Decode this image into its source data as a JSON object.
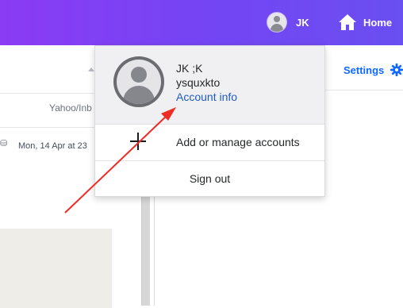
{
  "topbar": {
    "user_initials": "JK",
    "home_label": "Home"
  },
  "left_panel": {
    "folder_path": "Yahoo/Inb",
    "message_date": "Mon, 14 Apr at 23"
  },
  "right_panel": {
    "settings_label": "Settings"
  },
  "account_menu": {
    "display_name": "JK ;K",
    "username": "ysquxkto",
    "account_info_label": "Account info",
    "add_accounts_label": "Add or manage accounts",
    "sign_out_label": "Sign out"
  },
  "colors": {
    "topbar_gradient_start": "#8a3bf4",
    "topbar_gradient_end": "#6a4ff2",
    "link_blue": "#1d5dbf",
    "settings_blue": "#0f69ff",
    "annotation_red": "#ee2b24"
  },
  "icons": {
    "user": "avatar-icon",
    "home": "home-icon",
    "settings": "gear-icon",
    "add": "plus-icon",
    "sort": "caret-up-icon",
    "attachment": "attachment-icon"
  }
}
